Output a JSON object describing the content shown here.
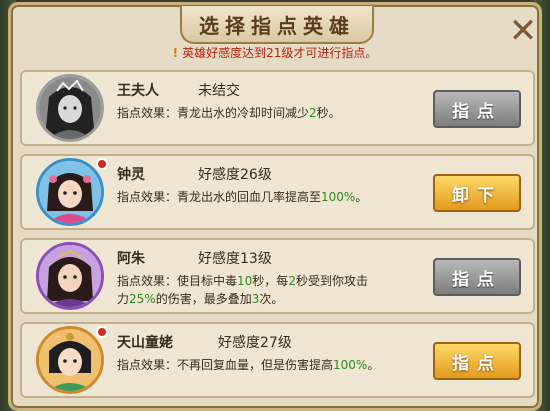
{
  "title": "选择指点英雄",
  "notice": "英雄好感度达到21级才可进行指点。",
  "close_icon": "close-x-icon",
  "heroes": [
    {
      "name": "王夫人",
      "status": "未结交",
      "effect_prefix": "指点效果：青龙出水的冷却时间减少",
      "effect_value": "2",
      "effect_suffix": "秒。",
      "button": "指点",
      "button_style": "gray",
      "has_dot": false,
      "portrait_gray": true,
      "colors": {
        "ring": "#b89c5a",
        "bg": "#8a8a8a",
        "hair": "#222222",
        "skin": "#d9d9d9",
        "robe": "#6a6a6a"
      }
    },
    {
      "name": "钟灵",
      "status": "好感度26级",
      "effect_prefix": "指点效果：青龙出水的回血几率提高至",
      "effect_value": "100%",
      "effect_suffix": "。",
      "button": "卸下",
      "button_style": "gold",
      "has_dot": true,
      "portrait_gray": false,
      "colors": {
        "ring": "#3a8fc9",
        "bg": "#7fc2e8",
        "hair": "#2b1a1a",
        "skin": "#f7d8c4",
        "robe": "#d94a8a"
      }
    },
    {
      "name": "阿朱",
      "status": "好感度13级",
      "effect_line1_prefix": "指点效果：使目标中毒",
      "effect_v1": "10",
      "effect_line1_mid1": "秒，每",
      "effect_v2": "2",
      "effect_line1_mid2": "秒受到你攻击",
      "effect_line2_prefix": "力",
      "effect_v3": "25%",
      "effect_line2_mid": "的伤害，最多叠加",
      "effect_v4": "3",
      "effect_line2_suffix": "次。",
      "button": "指点",
      "button_style": "gray",
      "has_dot": false,
      "portrait_gray": false,
      "colors": {
        "ring": "#8a4fb8",
        "bg": "#c7a2e0",
        "hair": "#2b1a1a",
        "skin": "#f4d4bc",
        "robe": "#6b3a90"
      }
    },
    {
      "name": "天山童姥",
      "status": "好感度27级",
      "effect_prefix": "指点效果：不再回复血量，但是伤害提高",
      "effect_value": "100%",
      "effect_suffix": "。",
      "button": "指点",
      "button_style": "gold",
      "has_dot": true,
      "portrait_gray": false,
      "colors": {
        "ring": "#d08a2a",
        "bg": "#f0c070",
        "hair": "#1e1e1e",
        "skin": "#f7dcc6",
        "robe": "#3f9a5a"
      }
    }
  ]
}
